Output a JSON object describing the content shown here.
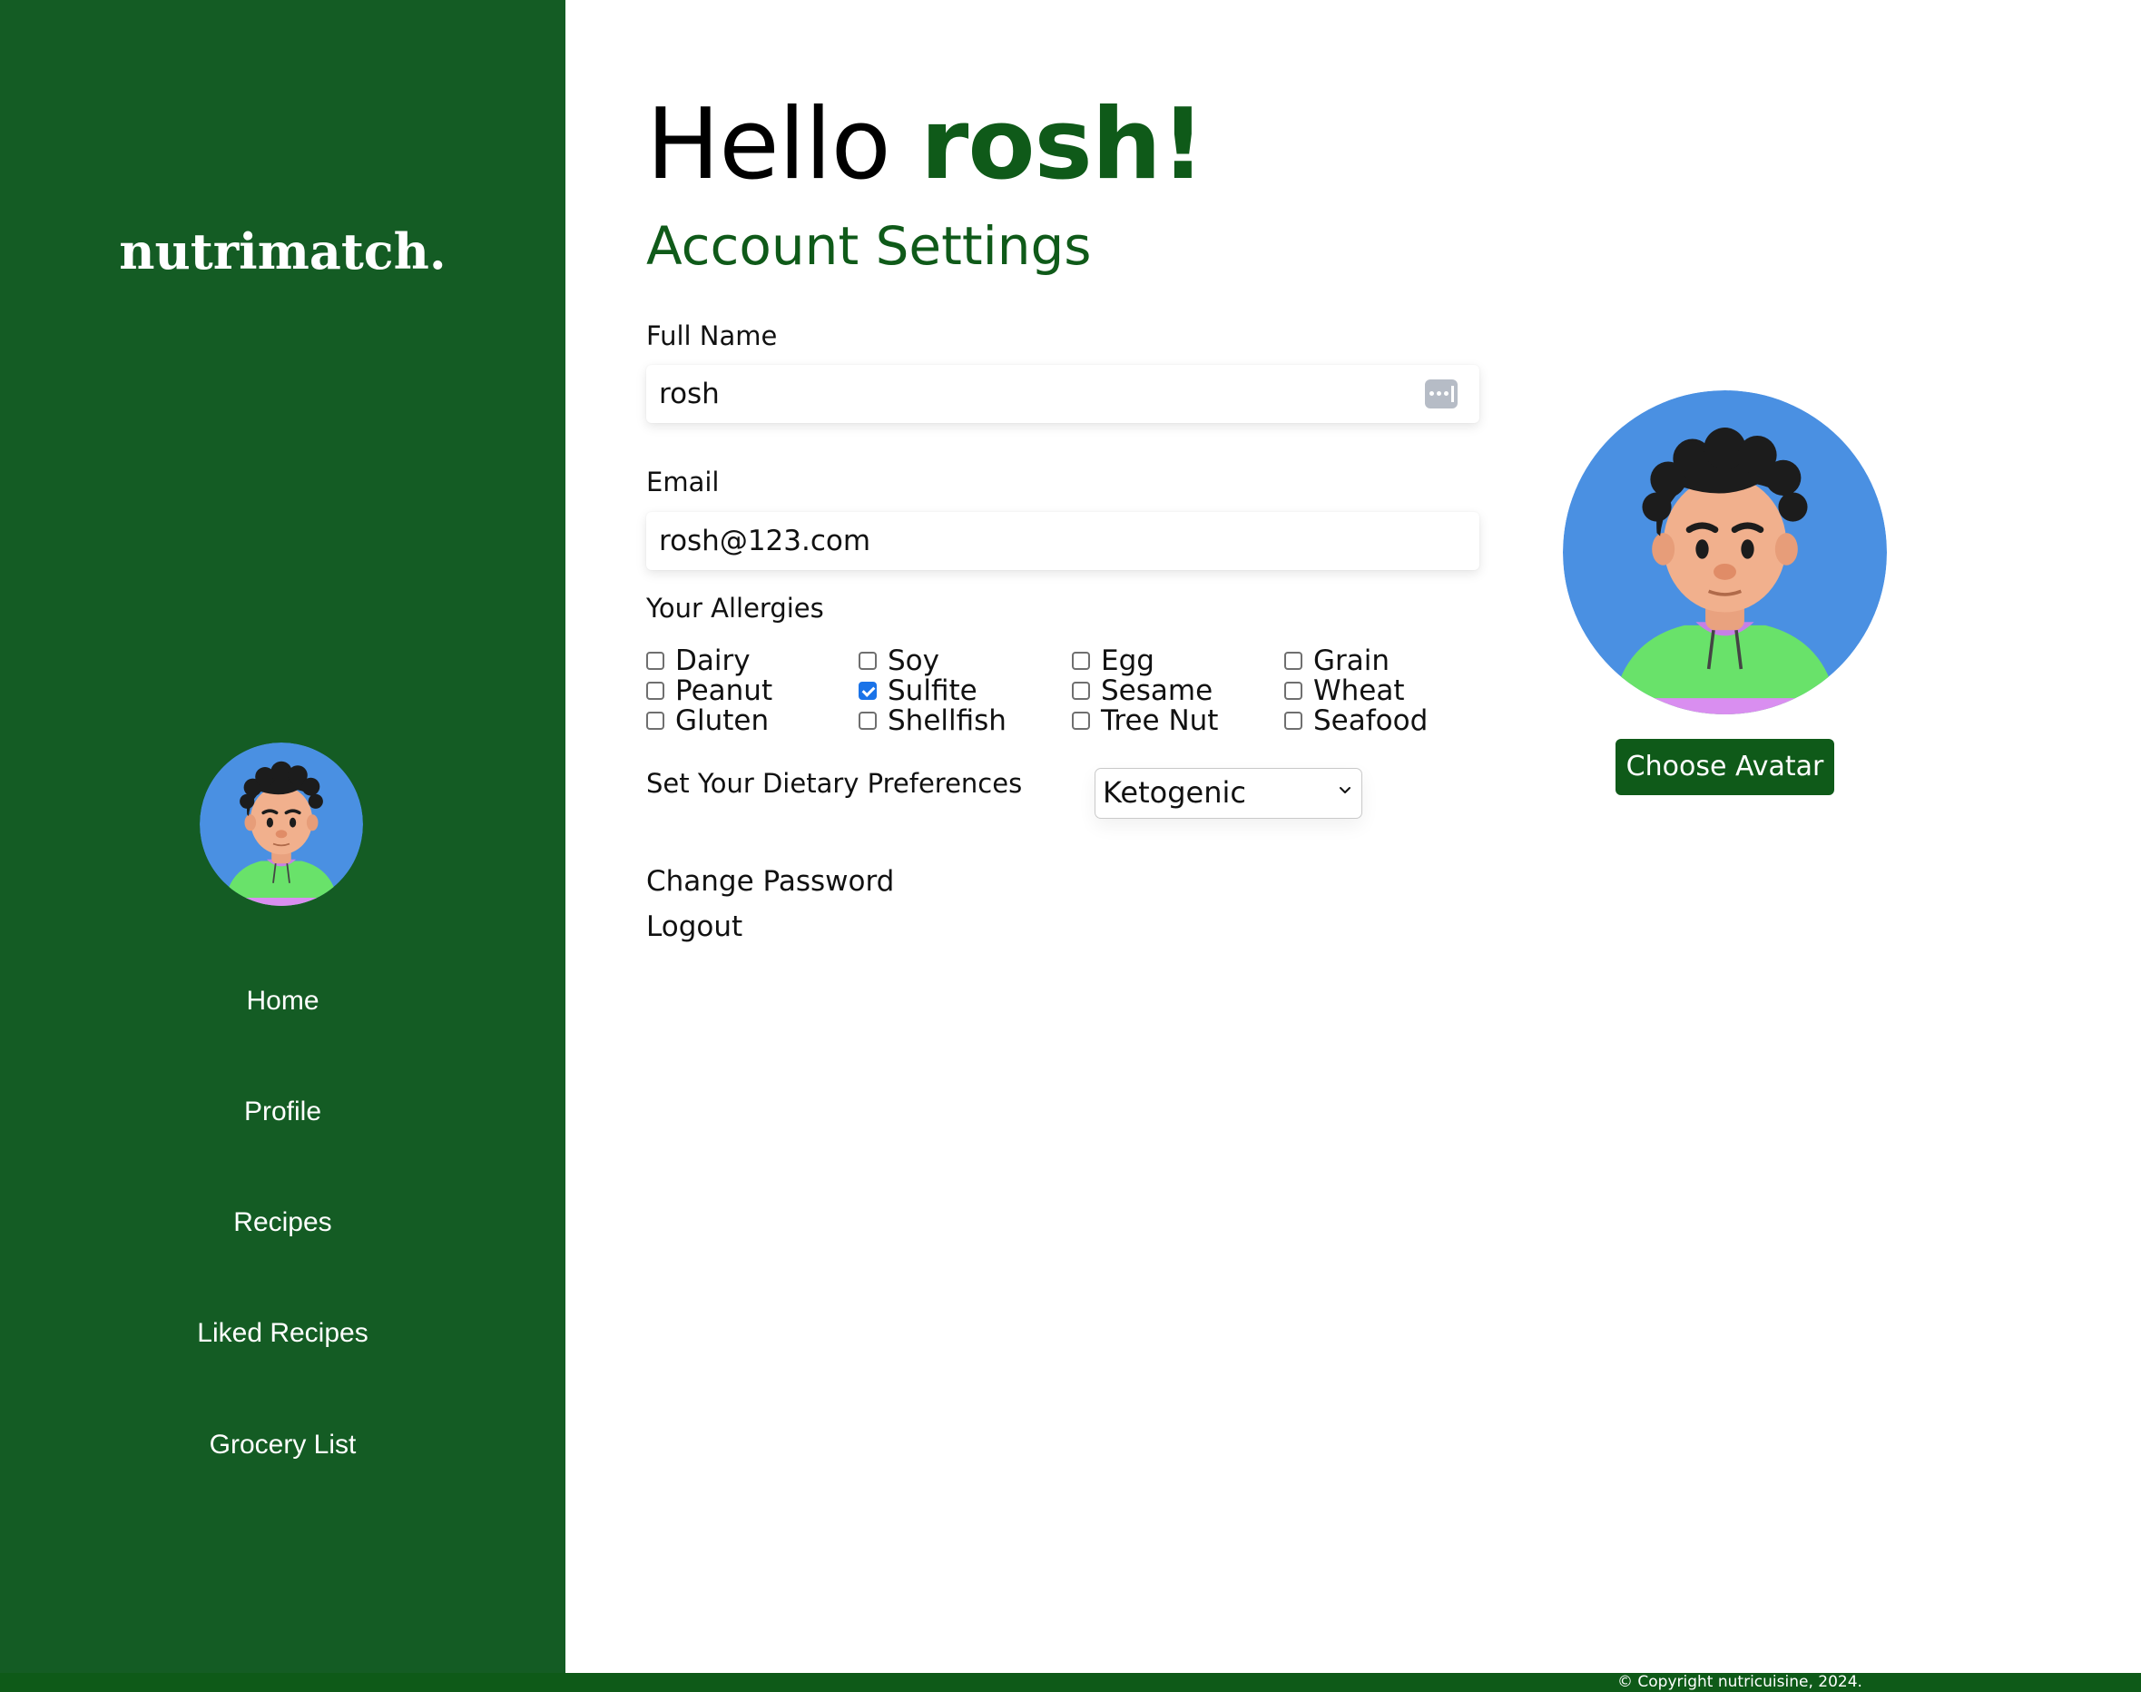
{
  "sidebar": {
    "brand": "nutrimatch.",
    "avatar": "user-avatar-illustration",
    "nav": [
      {
        "label": "Home",
        "icon": ""
      },
      {
        "label": "Profile"
      },
      {
        "label": "Recipes"
      },
      {
        "label": "Liked Recipes"
      },
      {
        "label": "Grocery List"
      }
    ]
  },
  "header": {
    "greeting": "Hello",
    "user_name": "rosh!"
  },
  "settings": {
    "title": "Account Settings",
    "full_name_label": "Full Name",
    "full_name_value": "rosh",
    "email_label": "Email",
    "email_value": "rosh@123.com",
    "allergies_label": "Your Allergies",
    "allergies": [
      {
        "label": "Dairy",
        "checked": false
      },
      {
        "label": "Soy",
        "checked": false
      },
      {
        "label": "Egg",
        "checked": false
      },
      {
        "label": "Grain",
        "checked": false
      },
      {
        "label": "Peanut",
        "checked": false
      },
      {
        "label": "Sulfite",
        "checked": true
      },
      {
        "label": "Sesame",
        "checked": false
      },
      {
        "label": "Wheat",
        "checked": false
      },
      {
        "label": "Gluten",
        "checked": false
      },
      {
        "label": "Shellfish",
        "checked": false
      },
      {
        "label": "Tree Nut",
        "checked": false
      },
      {
        "label": "Seafood",
        "checked": false
      }
    ],
    "diet_label": "Set Your Dietary Preferences",
    "diet_selected": "Ketogenic",
    "change_password": "Change Password",
    "logout": "Logout"
  },
  "avatar_panel": {
    "button_label": "Choose Avatar"
  },
  "footer": {
    "copyright": "© Copyright nutricuisine, 2024."
  },
  "colors": {
    "sidebar_bg": "#145c24",
    "accent_green": "#0f5a19",
    "checkbox_checked": "#1a73e8",
    "avatar_bg": "#4a90e2"
  }
}
